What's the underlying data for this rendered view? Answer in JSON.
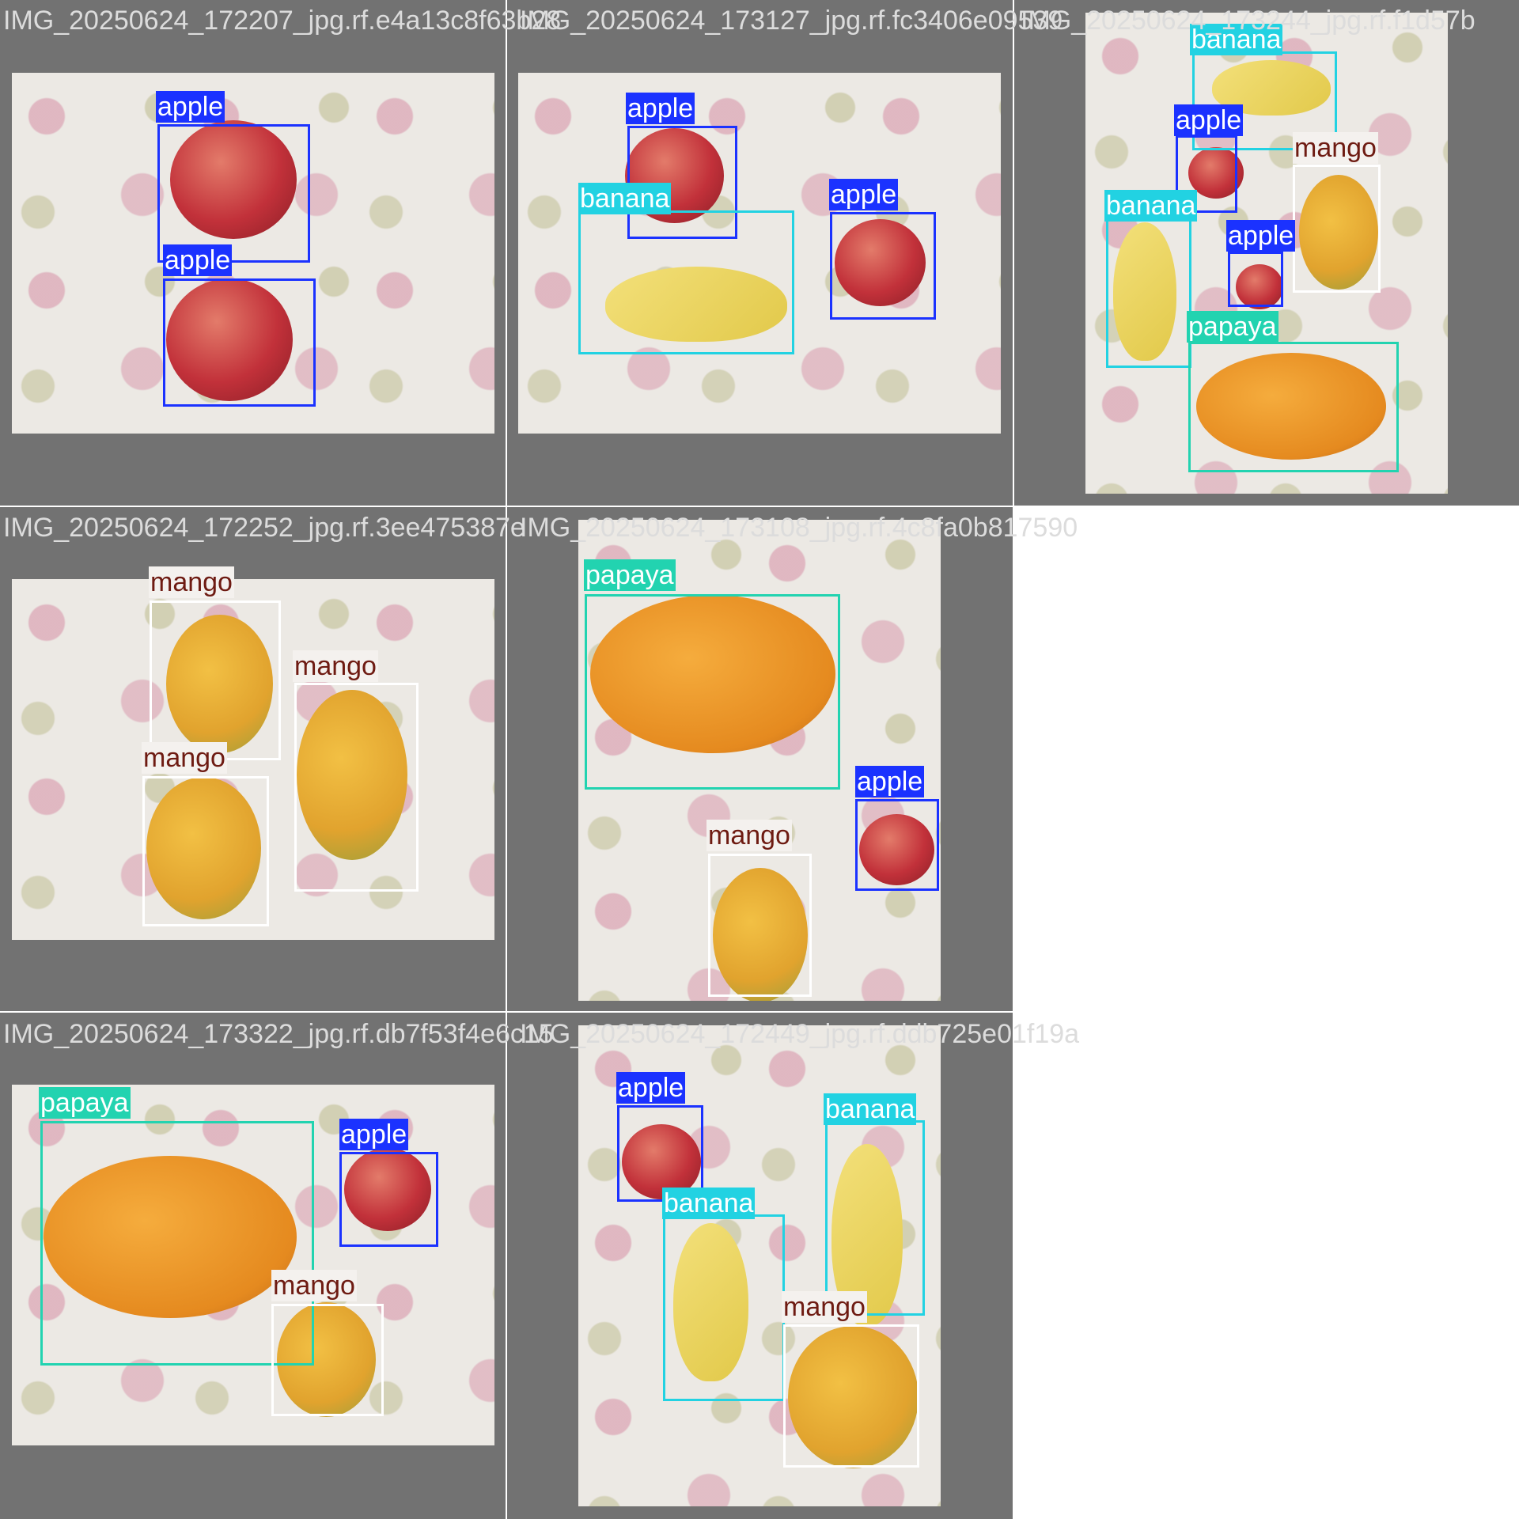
{
  "tiles": [
    {
      "filename": "IMG_20250624_172207_jpg.rf.e4a13c8f63b28"
    },
    {
      "filename": "IMG_20250624_173127_jpg.rf.fc3406e09539"
    },
    {
      "filename": "IMG_20250624_173244_jpg.rf.f1d57b"
    },
    {
      "filename": "IMG_20250624_172252_jpg.rf.3ee475387e"
    },
    {
      "filename": "IMG_20250624_173108_jpg.rf.4c8fa0b817590"
    },
    {
      "filename": "IMG_20250624_173322_jpg.rf.db7f53f4e6c15"
    },
    {
      "filename": "IMG_20250624_172449_jpg.rf.ddb725e01f19a"
    }
  ],
  "labels": {
    "apple": "apple",
    "banana": "banana",
    "mango": "mango",
    "papaya": "papaya"
  },
  "colors": {
    "apple": "#1b32ff",
    "banana": "#22d2e2",
    "mango": "#ffffff",
    "papaya": "#22d3b0"
  }
}
